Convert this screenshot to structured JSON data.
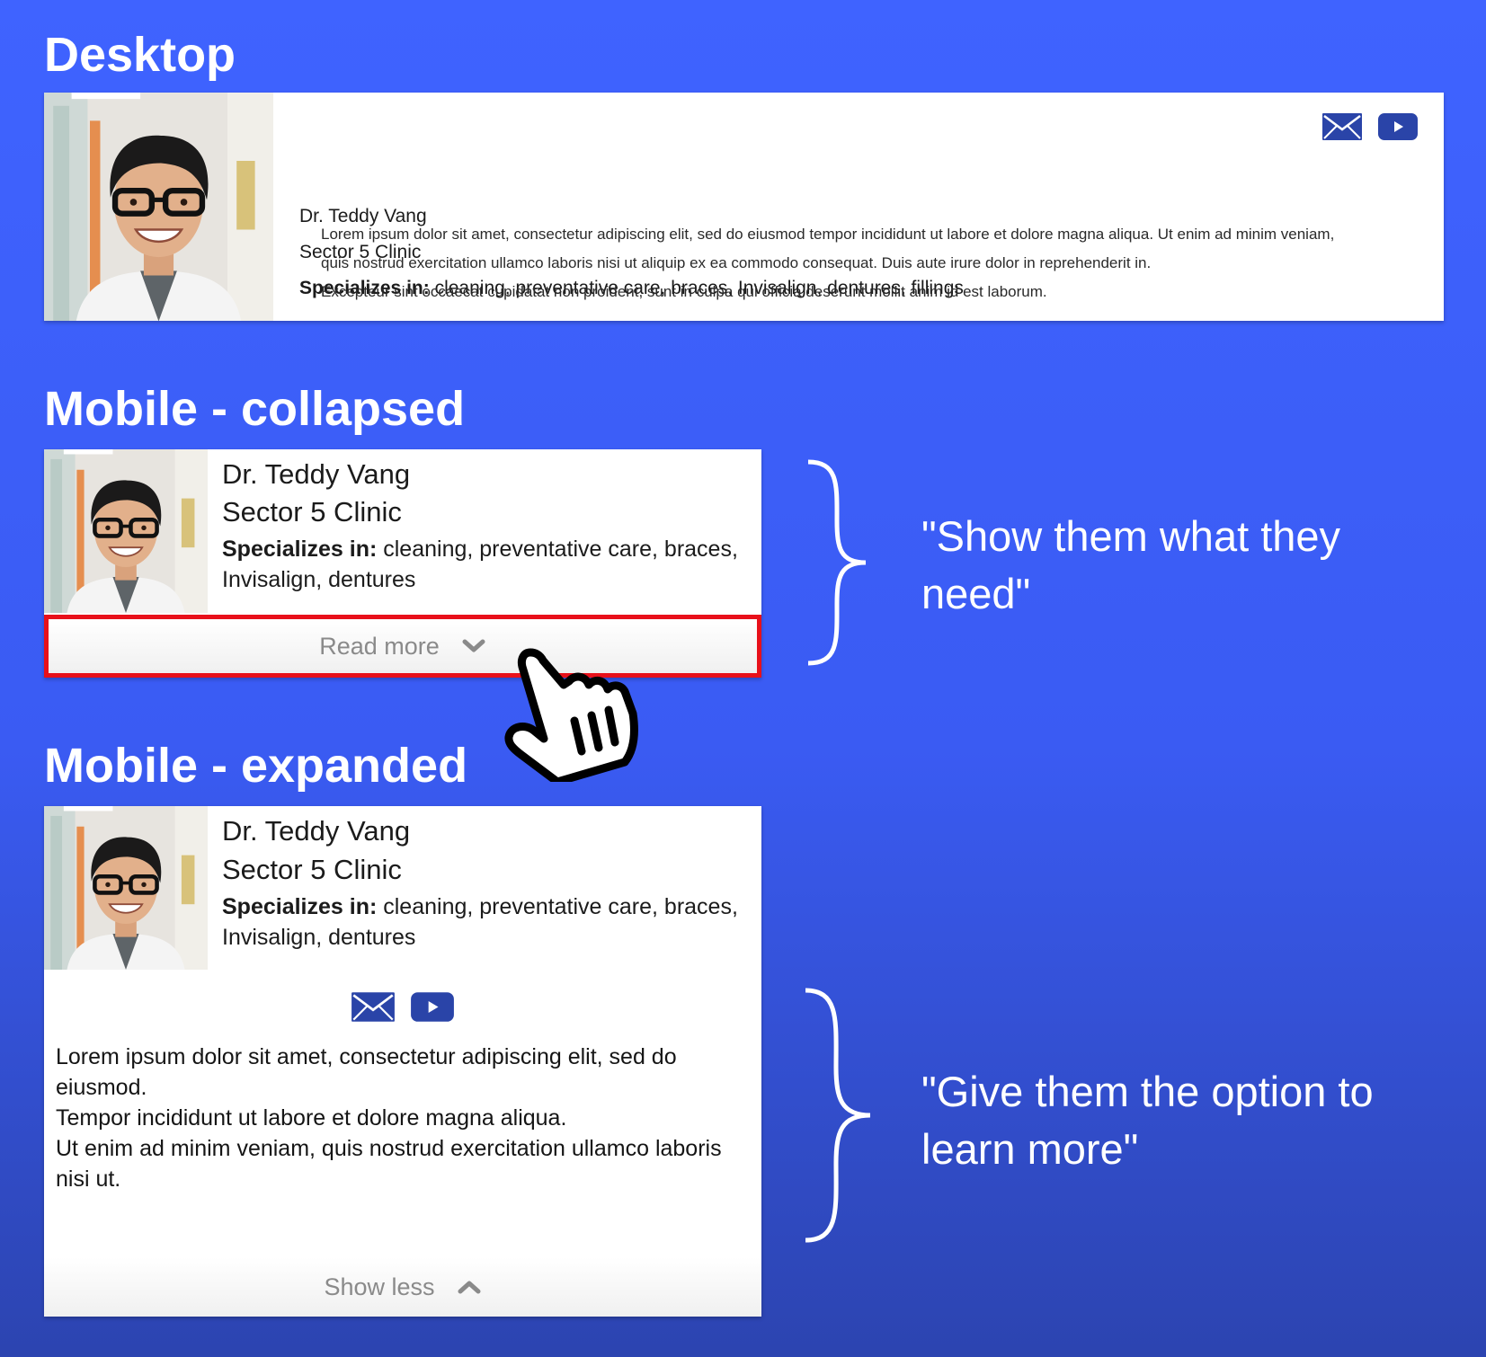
{
  "sections": {
    "desktop": "Desktop",
    "mobile_collapsed": "Mobile - collapsed",
    "mobile_expanded": "Mobile - expanded"
  },
  "doctor": {
    "name": "Dr. Teddy Vang",
    "clinic": "Sector 5 Clinic",
    "specializes_label": "Specializes in:",
    "specialties_full": " cleaning, preventative care, braces, Invisalign, dentures, fillings",
    "specialties_short": " cleaning, preventative care, braces, Invisalign, dentures"
  },
  "desktop_bio": [
    "Lorem ipsum dolor sit amet, consectetur adipiscing elit, sed do eiusmod tempor incididunt ut labore et dolore magna aliqua. Ut enim ad minim veniam,",
    "quis nostrud exercitation ullamco laboris nisi ut aliquip ex ea commodo consequat. Duis aute irure dolor in reprehenderit in.",
    "Excepteur sint occaecat cupidatat non proident, sunt in culpa qui officia deserunt mollit anim id est laborum."
  ],
  "mobile_bio": [
    "Lorem ipsum dolor sit amet, consectetur adipiscing elit, sed do eiusmod.",
    "Tempor incididunt ut labore et dolore magna aliqua.",
    "Ut enim ad minim veniam, quis nostrud exercitation ullamco laboris nisi ut."
  ],
  "buttons": {
    "read_more": "Read more",
    "show_less": "Show less"
  },
  "annotations": {
    "collapsed_quote": "\"Show them what they need\"",
    "expanded_quote": "\"Give them the option to learn more\""
  },
  "icons": {
    "email": "mail-icon",
    "video": "youtube-icon",
    "expand": "chevron-down-icon",
    "collapse": "chevron-up-icon",
    "pointer": "hand-cursor-icon"
  },
  "colors": {
    "background": "#3f63ff",
    "icon_blue": "#2a44a8",
    "highlight_red": "#e8101a",
    "toggle_text": "#8a8a8a"
  }
}
